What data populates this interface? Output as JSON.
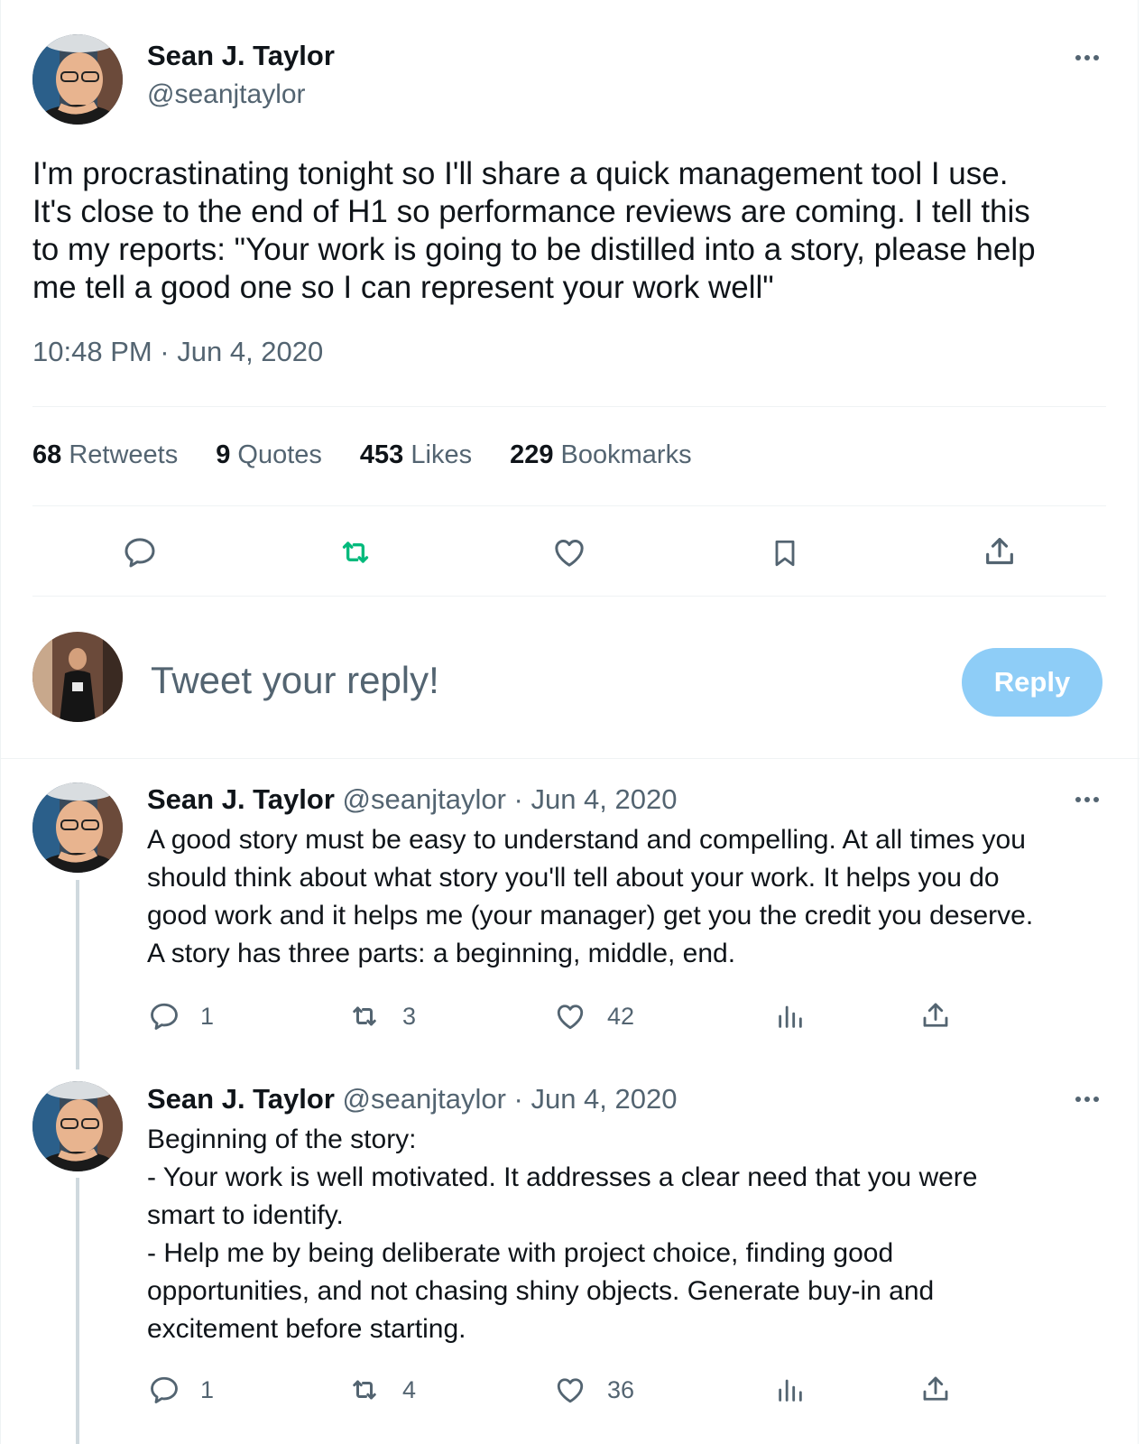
{
  "main_tweet": {
    "author_name": "Sean J. Taylor",
    "author_handle": "@seanjtaylor",
    "text": "I'm procrastinating tonight so I'll share a quick management tool I use.\nIt's close to the end of H1 so performance reviews are coming. I tell this\nto my reports: \"Your work is going to be distilled into a story, please help\nme tell a good one so I can represent your work well\"",
    "timestamp": "10:48 PM · Jun 4, 2020",
    "stats": {
      "retweets_count": "68",
      "retweets_label": "Retweets",
      "quotes_count": "9",
      "quotes_label": "Quotes",
      "likes_count": "453",
      "likes_label": "Likes",
      "bookmarks_count": "229",
      "bookmarks_label": "Bookmarks"
    },
    "icons": [
      "reply-icon",
      "retweet-icon",
      "like-icon",
      "bookmark-icon",
      "share-icon"
    ]
  },
  "composer": {
    "placeholder": "Tweet your reply!",
    "reply_button_label": "Reply"
  },
  "replies": [
    {
      "author_name": "Sean J. Taylor",
      "meta": "@seanjtaylor · Jun 4, 2020",
      "text": "A good story must be easy to understand and compelling. At all times you\nshould think about what story you'll tell about your work. It helps you do\ngood work and it helps me (your manager) get you the credit you deserve.\nA story has three parts: a beginning, middle, end.",
      "reply_count": "1",
      "retweet_count": "3",
      "like_count": "42"
    },
    {
      "author_name": "Sean J. Taylor",
      "meta": "@seanjtaylor · Jun 4, 2020",
      "text": "Beginning of the story:\n- Your work is well motivated. It addresses a clear need that you were\nsmart to identify.\n- Help me by being deliberate with project choice, finding good\nopportunities, and not chasing shiny objects. Generate buy-in and\nexcitement before starting.",
      "reply_count": "1",
      "retweet_count": "4",
      "like_count": "36"
    }
  ],
  "colors": {
    "text": "#0f1419",
    "muted": "#536471",
    "retweet_green": "#00ba7c",
    "reply_button": "#8ecdf7",
    "divider": "#eff3f4",
    "thread_line": "#cfd9de"
  }
}
